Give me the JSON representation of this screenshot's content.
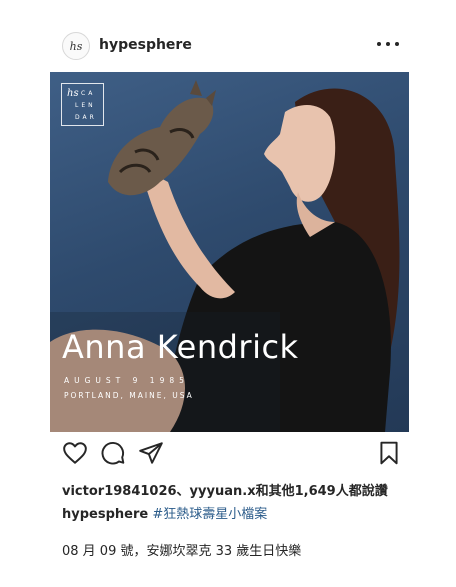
{
  "post": {
    "avatar_text": "hs",
    "username": "hypesphere",
    "more_icon": "more-horizontal-icon"
  },
  "image": {
    "logo_mark": "hs",
    "logo_line1": "CA",
    "logo_line2": "LEN",
    "logo_line3": "DAR",
    "name": "Anna Kendrick",
    "date": "AUGUST 9 1985",
    "place": "PORTLAND, MAINE, USA",
    "colors": {
      "background": "#3a5a80",
      "text": "#ffffff"
    }
  },
  "actions": {
    "like_icon": "heart-icon",
    "comment_icon": "comment-icon",
    "share_icon": "send-icon",
    "save_icon": "bookmark-icon"
  },
  "likes_text": "victor19841026、yyyuan.x和其他1,649人都說讚",
  "caption": {
    "user": "hypesphere",
    "hashtag": "#狂熱球壽星小檔案"
  },
  "description": "08 月 09 號，安娜坎翠克 33 歲生日快樂"
}
